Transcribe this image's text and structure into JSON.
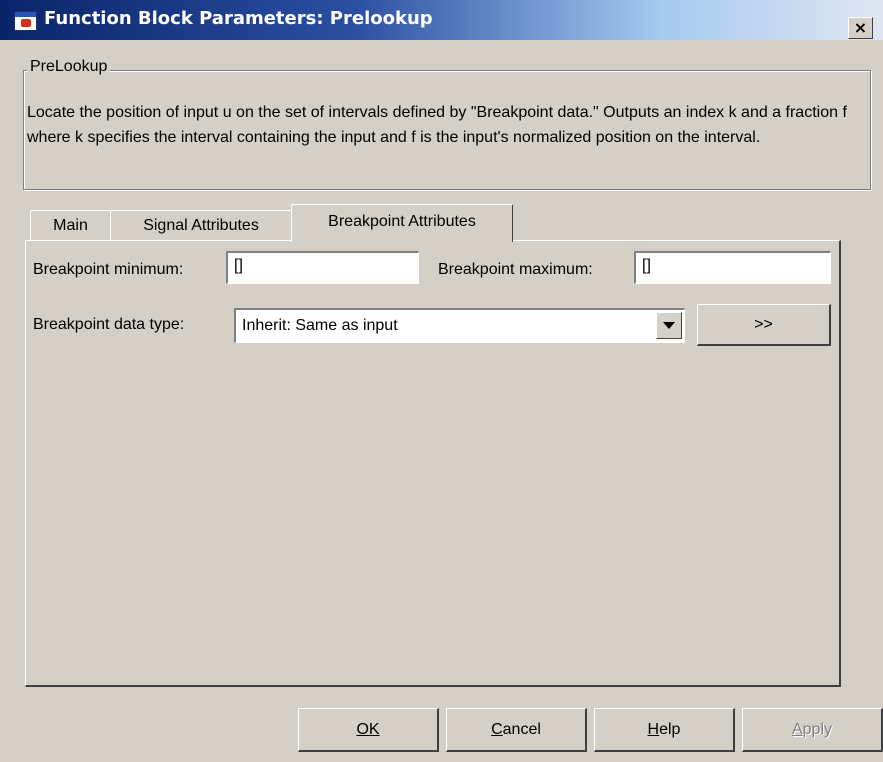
{
  "window": {
    "title": "Function Block Parameters: Prelookup",
    "close_label": "×"
  },
  "block": {
    "group_title": "PreLookup",
    "description": "Locate the position of input u on the set of intervals defined by \"Breakpoint data.\" Outputs an index k and a fraction f where k specifies the interval containing the input and f is the input's normalized position on the interval."
  },
  "tabs": {
    "main": "Main",
    "signal_attributes": "Signal Attributes",
    "breakpoint_attributes": "Breakpoint Attributes",
    "active": "Breakpoint Attributes"
  },
  "breakpoint_tab": {
    "min_label": "Breakpoint minimum:",
    "min_value": "[]",
    "max_label": "Breakpoint maximum:",
    "max_value": "[]",
    "data_type_label": "Breakpoint data type:",
    "data_type_value": "Inherit: Same as input",
    "assistant_button": ">>"
  },
  "buttons": {
    "ok": "OK",
    "cancel": "Cancel",
    "help": "Help",
    "apply": "Apply",
    "apply_enabled": false
  },
  "icons": {
    "app": "simulink-block-icon",
    "close": "close-icon",
    "dropdown": "chevron-down-icon"
  }
}
